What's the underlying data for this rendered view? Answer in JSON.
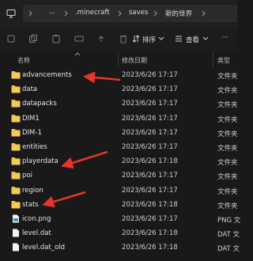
{
  "address": {
    "more": "...",
    "crumbs": [
      ".minecraft",
      "saves",
      "新的世界"
    ]
  },
  "toolbar": {
    "sort_label": "排序",
    "view_label": "查看",
    "more": "···"
  },
  "columns": {
    "name": "名称",
    "modified": "修改日期",
    "type": "类型"
  },
  "files": [
    {
      "name": "advancements",
      "modified": "2023/6/26 17:17",
      "type": "文件夹",
      "icon": "folder-icon"
    },
    {
      "name": "data",
      "modified": "2023/6/26 17:17",
      "type": "文件夹",
      "icon": "folder-icon"
    },
    {
      "name": "datapacks",
      "modified": "2023/6/26 17:17",
      "type": "文件夹",
      "icon": "folder-icon"
    },
    {
      "name": "DIM1",
      "modified": "2023/6/26 17:17",
      "type": "文件夹",
      "icon": "folder-icon"
    },
    {
      "name": "DIM-1",
      "modified": "2023/6/26 17:17",
      "type": "文件夹",
      "icon": "folder-icon"
    },
    {
      "name": "entities",
      "modified": "2023/6/26 17:17",
      "type": "文件夹",
      "icon": "folder-icon"
    },
    {
      "name": "playerdata",
      "modified": "2023/6/26 17:18",
      "type": "文件夹",
      "icon": "folder-icon"
    },
    {
      "name": "poi",
      "modified": "2023/6/26 17:17",
      "type": "文件夹",
      "icon": "folder-icon"
    },
    {
      "name": "region",
      "modified": "2023/6/26 17:17",
      "type": "文件夹",
      "icon": "folder-icon"
    },
    {
      "name": "stats",
      "modified": "2023/6/26 17:18",
      "type": "文件夹",
      "icon": "folder-icon"
    },
    {
      "name": "icon.png",
      "modified": "2023/6/26 17:17",
      "type": "PNG 文",
      "icon": "image-file-icon"
    },
    {
      "name": "level.dat",
      "modified": "2023/6/26 17:18",
      "type": "DAT 文",
      "icon": "file-icon"
    },
    {
      "name": "level.dat_old",
      "modified": "2023/6/26 17:18",
      "type": "DAT 文",
      "icon": "file-icon"
    }
  ],
  "colors": {
    "folder": "#f2c04b",
    "arrow": "#e8342c",
    "background": "#191919"
  }
}
